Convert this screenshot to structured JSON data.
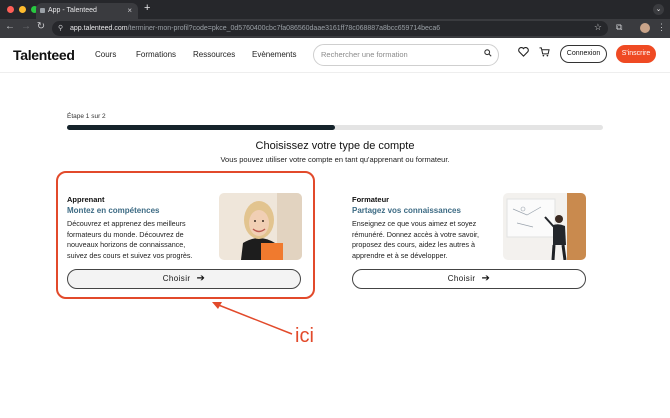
{
  "browser": {
    "tab_title": "App - Talenteed",
    "new_tab": "+",
    "tab_close": "×",
    "url_host": "app.talenteed.com",
    "url_path": "/terminer-mon-profil?code=pkce_0d5760400cbc7fa086560daae3161ff78c068887a8bcc659714beca6"
  },
  "header": {
    "logo": "Talenteed",
    "nav": [
      "Cours",
      "Formations",
      "Ressources",
      "Evènements"
    ],
    "search_placeholder": "Rechercher une formation",
    "login": "Connexion",
    "signup": "S'inscrire"
  },
  "step": {
    "label": "Étape 1 sur 2",
    "progress": 0.5
  },
  "heading": "Choisissez votre type de compte",
  "subheading": "Vous pouvez utiliser votre compte en tant qu'apprenant ou formateur.",
  "cards": [
    {
      "title": "Apprenant",
      "subtitle": "Montez en compétences",
      "description": "Découvrez et apprenez des meilleurs formateurs du monde. Découvrez de nouveaux horizons de connaissance, suivez des cours et suivez vos progrès.",
      "button": "Choisir"
    },
    {
      "title": "Formateur",
      "subtitle": "Partagez vos connaissances",
      "description": "Enseignez ce que vous aimez et soyez rémunéré. Donnez accès à votre savoir, proposez des cours, aidez les autres à apprendre et à se développer.",
      "button": "Choisir"
    }
  ],
  "annotation": {
    "text": "ici",
    "color": "#e24a2b"
  },
  "colors": {
    "accent": "#ef4a23",
    "subtitle": "#3d6b84",
    "progress": "#15232b"
  }
}
